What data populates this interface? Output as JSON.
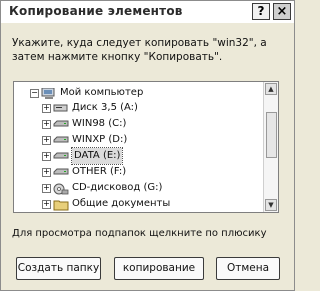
{
  "window": {
    "title": "Копирование элементов"
  },
  "titlebar": {
    "help_label": "?",
    "close_label": "×"
  },
  "instruction": "Укажите, куда следует копировать \"win32\", а затем нажмите кнопку \"Копировать\".",
  "tree": {
    "root": {
      "label": "Мой компьютер",
      "expander": "−",
      "icon": "computer-icon"
    },
    "items": [
      {
        "label": "Диск 3,5 (A:)",
        "expander": "+",
        "icon": "floppy-drive-icon"
      },
      {
        "label": "WIN98 (C:)",
        "expander": "+",
        "icon": "hard-drive-icon"
      },
      {
        "label": "WINXP (D:)",
        "expander": "+",
        "icon": "hard-drive-icon"
      },
      {
        "label": "DATA (E:)",
        "expander": "+",
        "icon": "hard-drive-icon",
        "selected": true
      },
      {
        "label": "OTHER (F:)",
        "expander": "+",
        "icon": "hard-drive-icon"
      },
      {
        "label": "CD-дисковод (G:)",
        "expander": "+",
        "icon": "cd-drive-icon"
      },
      {
        "label": "Общие документы",
        "expander": "+",
        "icon": "folder-icon"
      }
    ]
  },
  "hint": "Для просмотра подпапок щелкните по плюсику",
  "buttons": {
    "new_folder": "Создать папку",
    "copy": "копирование",
    "cancel": "Отмена"
  }
}
